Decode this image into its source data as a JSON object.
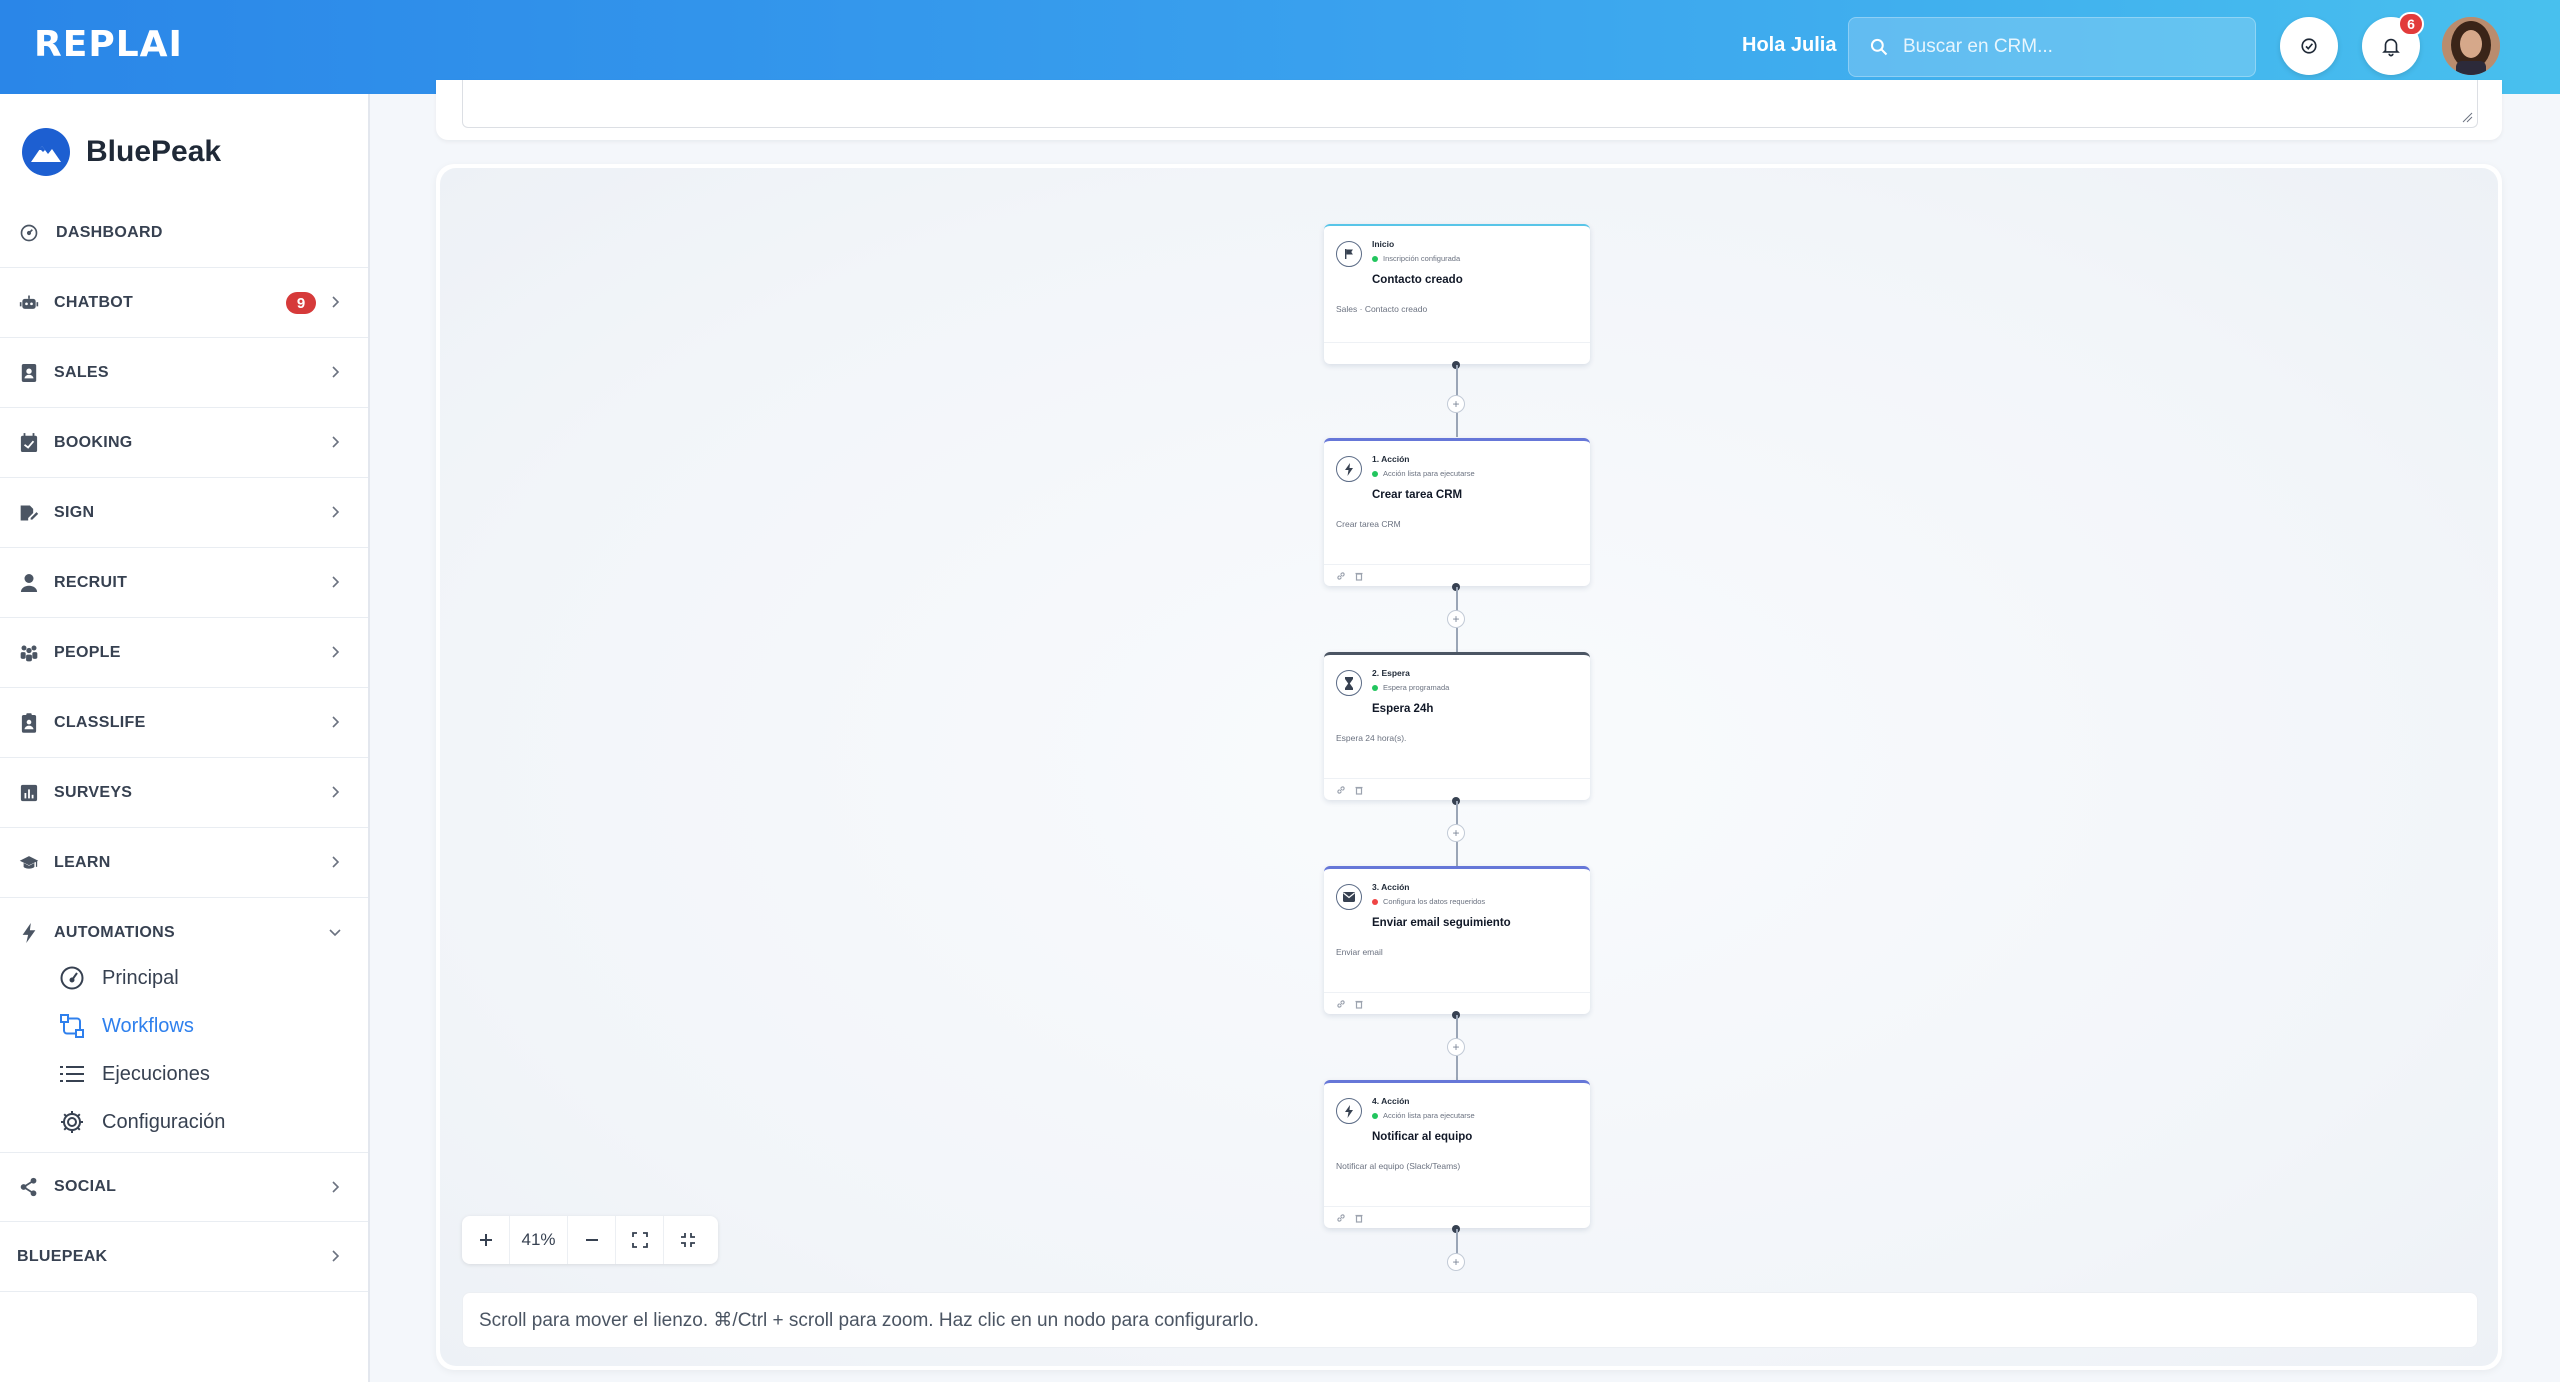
{
  "header": {
    "logo": "REPLAI",
    "greeting": "Hola Julia",
    "search_placeholder": "Buscar en CRM...",
    "notifications_count": "6"
  },
  "sidebar": {
    "brand": "BluePeak",
    "items": [
      {
        "label": "DASHBOARD",
        "icon": "dashboard-icon"
      },
      {
        "label": "CHATBOT",
        "icon": "robot-icon",
        "count": "9"
      },
      {
        "label": "SALES",
        "icon": "contacts-icon"
      },
      {
        "label": "BOOKING",
        "icon": "calendar-check-icon"
      },
      {
        "label": "SIGN",
        "icon": "signature-icon"
      },
      {
        "label": "RECRUIT",
        "icon": "user-tie-icon"
      },
      {
        "label": "PEOPLE",
        "icon": "people-icon"
      },
      {
        "label": "CLASSLIFE",
        "icon": "id-badge-icon"
      },
      {
        "label": "SURVEYS",
        "icon": "chart-icon"
      },
      {
        "label": "LEARN",
        "icon": "graduation-cap-icon"
      },
      {
        "label": "AUTOMATIONS",
        "icon": "bolt-icon"
      },
      {
        "label": "SOCIAL",
        "icon": "share-icon"
      },
      {
        "label": "BLUEPEAK"
      }
    ],
    "automations_sub": [
      {
        "label": "Principal",
        "icon": "gauge-icon"
      },
      {
        "label": "Workflows",
        "icon": "workflow-icon",
        "active": true
      },
      {
        "label": "Ejecuciones",
        "icon": "list-icon"
      },
      {
        "label": "Configuración",
        "icon": "gear-icon"
      }
    ]
  },
  "workflow": {
    "nodes": [
      {
        "type": "Inicio",
        "status": "Inscripción configurada",
        "status_color": "#22c55e",
        "title": "Contacto creado",
        "desc": "Sales · Contacto creado",
        "accent": "#58c5e8",
        "icon": "flag-icon"
      },
      {
        "type": "1. Acción",
        "status": "Acción lista para ejecutarse",
        "status_color": "#22c55e",
        "title": "Crear tarea CRM",
        "desc": "Crear tarea CRM",
        "accent": "#6677d8",
        "icon": "bolt-icon"
      },
      {
        "type": "2. Espera",
        "status": "Espera programada",
        "status_color": "#22c55e",
        "title": "Espera 24h",
        "desc": "Espera 24 hora(s).",
        "accent": "#4b5563",
        "icon": "hourglass-icon"
      },
      {
        "type": "3. Acción",
        "status": "Configura los datos requeridos",
        "status_color": "#ef4444",
        "title": "Enviar email seguimiento",
        "desc": "Enviar email",
        "accent": "#6677d8",
        "icon": "email-icon"
      },
      {
        "type": "4. Acción",
        "status": "Acción lista para ejecutarse",
        "status_color": "#22c55e",
        "title": "Notificar al equipo",
        "desc": "Notificar al equipo (Slack/Teams)",
        "accent": "#6677d8",
        "icon": "bolt-icon"
      }
    ],
    "zoom": "41%",
    "help": "Scroll para mover el lienzo. ⌘/Ctrl + scroll para zoom. Haz clic en un nodo para configurarlo."
  },
  "colors": {
    "header_start": "#2a86e8",
    "header_end": "#48c0ee",
    "active": "#2f80ed",
    "badge": "#d63a3a"
  }
}
